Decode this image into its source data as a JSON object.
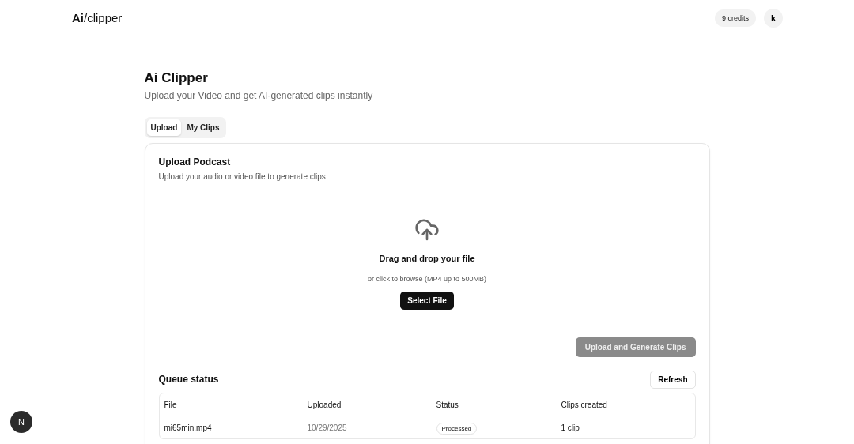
{
  "header": {
    "logo": "**Ai**/clipper",
    "credits": "9 credits",
    "avatar": "k"
  },
  "page": {
    "title": "Ai Clipper",
    "subtitle": "Upload your Video and get AI-generated clips instantly"
  },
  "tabs": [
    {
      "label": "Upload",
      "selected": true
    },
    {
      "label": "My Clips",
      "selected": false
    }
  ],
  "upload_card": {
    "title": "Upload Podcast",
    "description": "Upload your audio or video file to generate clips",
    "drop_title": "Drag and drop your file",
    "drop_hint": "or click to browse (MP4 up to 500MB)",
    "select_button": "Select File",
    "submit_button": {
      "label": "Upload and Generate Clips",
      "disabled": true
    }
  },
  "queue": {
    "title": "Queue status",
    "refresh_button": "Refresh",
    "columns": [
      "File",
      "Uploaded",
      "Status",
      "Clips created"
    ],
    "rows": [
      {
        "file": "mi65min.mp4",
        "uploaded": "10/29/2025",
        "status": "Processed",
        "clips": "1 clip"
      }
    ]
  },
  "dev_indicator": {
    "label": "N"
  }
}
